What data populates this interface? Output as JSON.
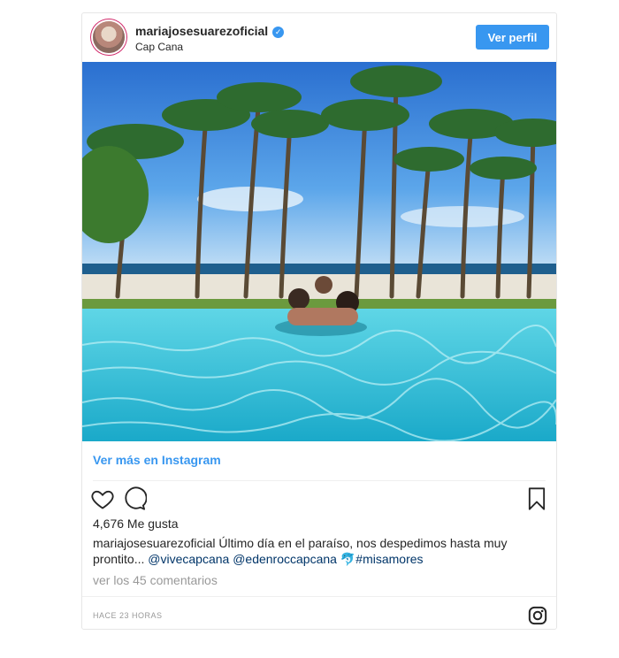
{
  "post": {
    "username": "mariajosesuarezoficial",
    "location": "Cap Cana",
    "view_profile_label": "Ver perfil",
    "view_more_label": "Ver más en Instagram",
    "likes_text": "4,676 Me gusta",
    "caption": {
      "author": "mariajosesuarezoficial",
      "text": " Último día en el paraíso, nos despedimos hasta muy prontito... ",
      "mention1": "@vivecapcana",
      "mention2": "@edenroccapcana",
      "emoji": "🐬",
      "hashtag": "#misamores"
    },
    "comments_link": "ver los 45 comentarios",
    "timestamp": "HACE 23 HORAS"
  },
  "icons": {
    "verified": "verified-badge-icon",
    "like": "heart-icon",
    "comment": "comment-bubble-icon",
    "save": "bookmark-icon",
    "brand": "instagram-logo-icon"
  },
  "colors": {
    "accent": "#3897f0",
    "link": "#003569",
    "muted": "#999999",
    "text": "#262626",
    "pool": "#3fc4d8",
    "sky": "#2f78d6"
  }
}
